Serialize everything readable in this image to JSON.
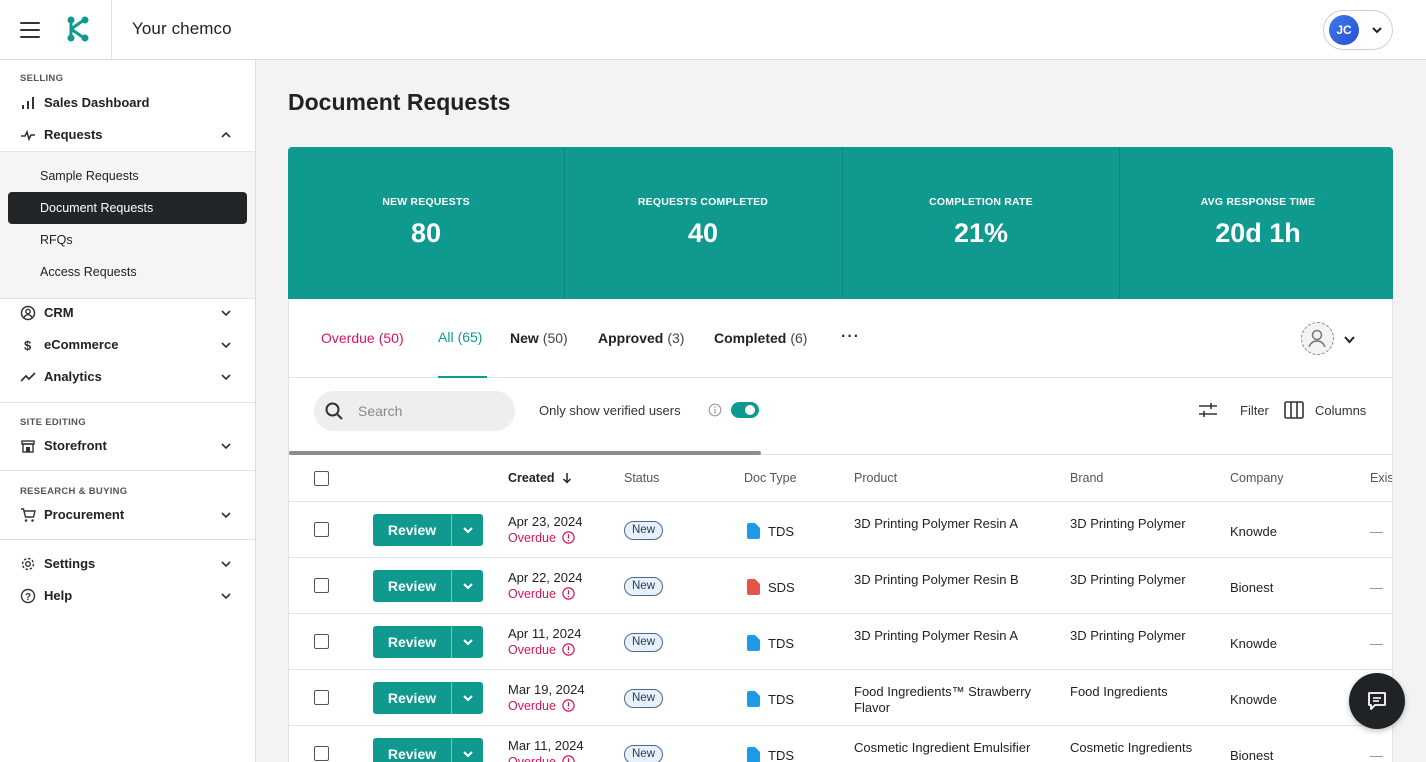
{
  "app": {
    "title": "Your chemco"
  },
  "user": {
    "initials": "JC"
  },
  "sidebar": {
    "sections": {
      "selling": "SELLING",
      "site_editing": "SITE EDITING",
      "research_buying": "RESEARCH & BUYING"
    },
    "items": {
      "sales_dashboard": "Sales Dashboard",
      "requests": "Requests",
      "crm": "CRM",
      "ecommerce": "eCommerce",
      "analytics": "Analytics",
      "storefront": "Storefront",
      "procurement": "Procurement",
      "settings": "Settings",
      "help": "Help"
    },
    "request_subitems": [
      "Sample Requests",
      "Document Requests",
      "RFQs",
      "Access Requests"
    ],
    "active_subitem": "Document Requests"
  },
  "page": {
    "title": "Document Requests"
  },
  "stats": [
    {
      "label": "NEW REQUESTS",
      "value": "80"
    },
    {
      "label": "REQUESTS COMPLETED",
      "value": "40"
    },
    {
      "label": "COMPLETION RATE",
      "value": "21%"
    },
    {
      "label": "AVG RESPONSE TIME",
      "value": "20d 1h"
    }
  ],
  "tabs": [
    {
      "name": "Overdue",
      "count": "(50)"
    },
    {
      "name": "All",
      "count": "(65)"
    },
    {
      "name": "New",
      "count": "(50)"
    },
    {
      "name": "Approved",
      "count": "(3)"
    },
    {
      "name": "Completed",
      "count": "(6)"
    }
  ],
  "tabs_more": "···",
  "toolbar": {
    "search_placeholder": "Search",
    "verified_label": "Only show verified users",
    "verified_on": true,
    "filter_label": "Filter",
    "columns_label": "Columns"
  },
  "table": {
    "columns": [
      "Created",
      "Status",
      "Doc Type",
      "Product",
      "Brand",
      "Company",
      "Exis"
    ],
    "sorted_column": "Created",
    "review_label": "Review",
    "overdue_label": "Overdue",
    "rows": [
      {
        "date": "Apr 23, 2024",
        "overdue": true,
        "status": "New",
        "doc_type": "TDS",
        "doc_color": "#1e9be8",
        "product": "3D Printing Polymer Resin A",
        "brand": "3D Printing Polymer",
        "company": "Knowde",
        "existing": "—"
      },
      {
        "date": "Apr 22, 2024",
        "overdue": true,
        "status": "New",
        "doc_type": "SDS",
        "doc_color": "#e5534b",
        "product": "3D Printing Polymer Resin B",
        "brand": "3D Printing Polymer",
        "company": "Bionest",
        "existing": "—"
      },
      {
        "date": "Apr 11, 2024",
        "overdue": true,
        "status": "New",
        "doc_type": "TDS",
        "doc_color": "#1e9be8",
        "product": "3D Printing Polymer Resin A",
        "brand": "3D Printing Polymer",
        "company": "Knowde",
        "existing": "—"
      },
      {
        "date": "Mar 19, 2024",
        "overdue": true,
        "status": "New",
        "doc_type": "TDS",
        "doc_color": "#1e9be8",
        "product": "Food Ingredients™ Strawberry Flavor",
        "brand": "Food Ingredients",
        "company": "Knowde",
        "existing": ""
      },
      {
        "date": "Mar 11, 2024",
        "overdue": true,
        "status": "New",
        "doc_type": "TDS",
        "doc_color": "#1e9be8",
        "product": "Cosmetic Ingredient Emulsifier",
        "brand": "Cosmetic Ingredients",
        "company": "Bionest",
        "existing": "—"
      }
    ]
  },
  "colors": {
    "accent": "#10998f",
    "overdue": "#d2155e",
    "active_nav": "#232629"
  }
}
